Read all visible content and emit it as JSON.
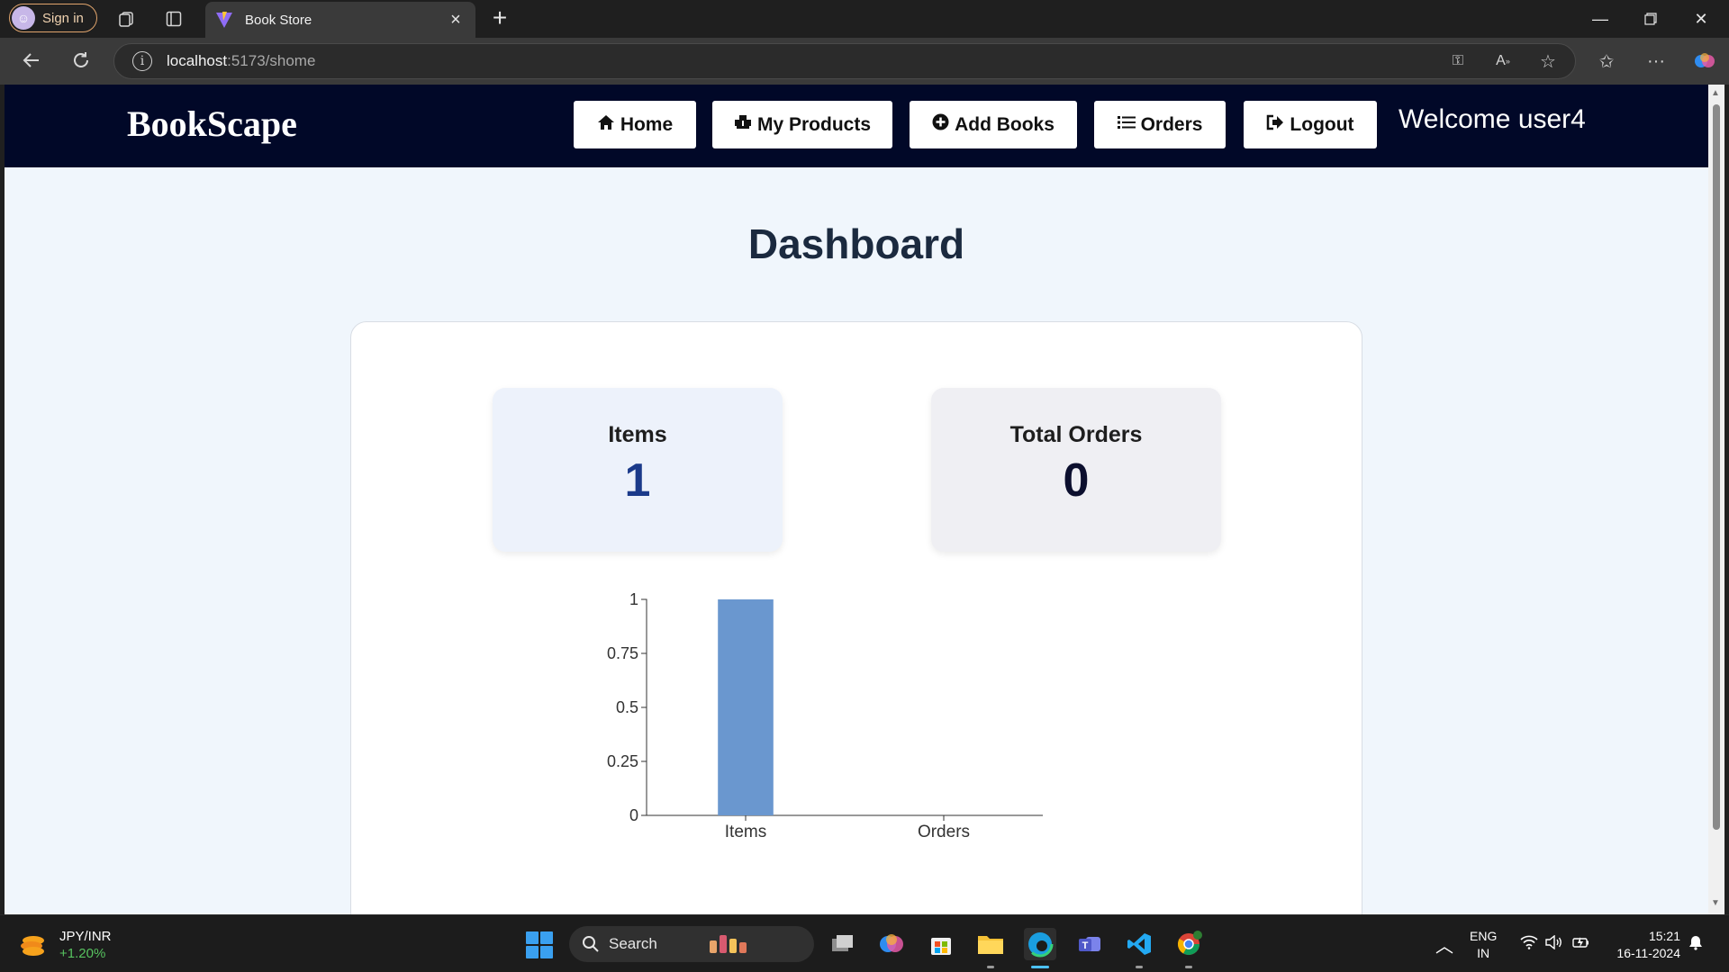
{
  "browser": {
    "signin_label": "Sign in",
    "tab_title": "Book Store",
    "url_host": "localhost",
    "url_rest": ":5173/shome"
  },
  "navbar": {
    "brand": "BookScape",
    "buttons": [
      {
        "label": "Home",
        "icon": "home-icon"
      },
      {
        "label": "My Products",
        "icon": "boxes-icon"
      },
      {
        "label": "Add Books",
        "icon": "plus-circle-icon"
      },
      {
        "label": "Orders",
        "icon": "list-icon"
      },
      {
        "label": "Logout",
        "icon": "logout-icon"
      }
    ],
    "welcome": "Welcome user4"
  },
  "dashboard": {
    "title": "Dashboard",
    "stats": [
      {
        "label": "Items",
        "value": "1",
        "bg": "#edf2fb",
        "color": "#1b3a8a"
      },
      {
        "label": "Total Orders",
        "value": "0",
        "bg": "#efeff3",
        "color": "#0c0f2e"
      }
    ]
  },
  "chart_data": {
    "type": "bar",
    "categories": [
      "Items",
      "Orders"
    ],
    "values": [
      1,
      0
    ],
    "yticks": [
      "0",
      "0.25",
      "0.5",
      "0.75",
      "1"
    ],
    "ylim": [
      0,
      1
    ],
    "bar_color": "#6a97cf",
    "grid": false
  },
  "taskbar": {
    "ticker_symbol": "JPY/INR",
    "ticker_change": "+1.20%",
    "search_label": "Search",
    "lang_top": "ENG",
    "lang_bottom": "IN",
    "time": "15:21",
    "date": "16-11-2024"
  }
}
